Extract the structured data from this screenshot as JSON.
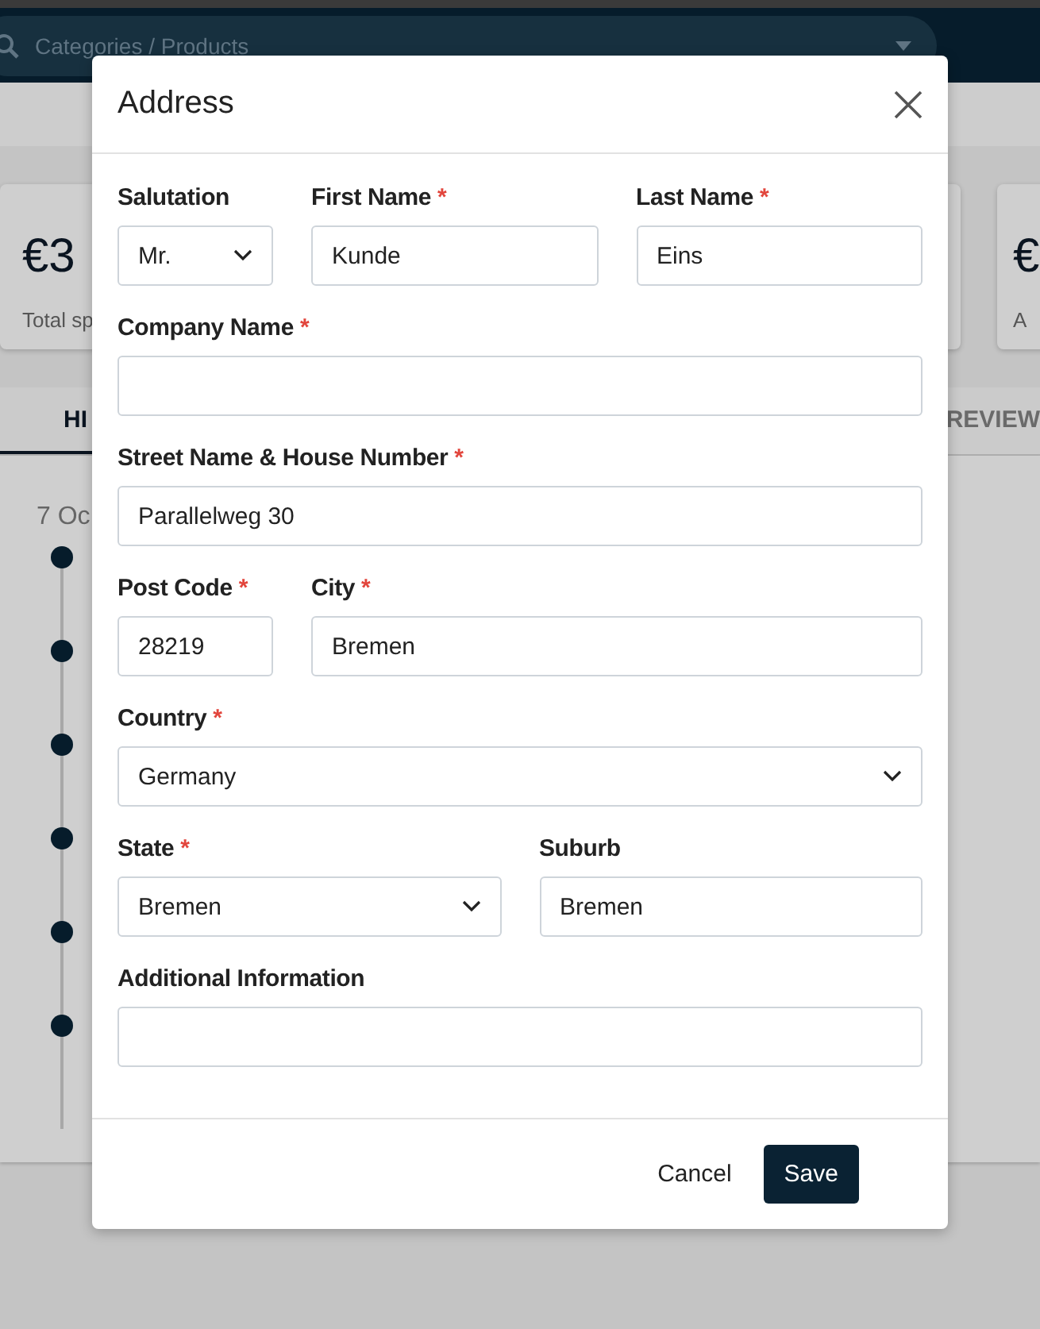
{
  "header": {
    "search": {
      "placeholder": "Categories / Products"
    }
  },
  "cards": [
    {
      "value": "€3",
      "label": "Total sp"
    },
    {
      "value": "€",
      "label": "A"
    }
  ],
  "tabs": [
    {
      "label": "HI",
      "selected": true
    },
    {
      "label": "REVIEW",
      "selected": false
    }
  ],
  "timeline": {
    "date": "7 Oc"
  },
  "dialog": {
    "title": "Address",
    "required_marker": "*",
    "rows": [
      [
        {
          "label": "Salutation",
          "required": false,
          "kind": "select",
          "value": "Mr."
        },
        {
          "label": "First Name",
          "required": true,
          "kind": "text",
          "value": "Kunde"
        },
        {
          "label": "Last Name",
          "required": true,
          "kind": "text",
          "value": "Eins"
        }
      ],
      [
        {
          "label": "Company Name",
          "required": true,
          "kind": "text"
        }
      ],
      [
        {
          "label": "Street Name & House Number",
          "required": true,
          "kind": "text",
          "value": "Parallelweg 30"
        }
      ],
      [
        {
          "label": "Post Code",
          "required": true,
          "kind": "text",
          "value": "28219"
        },
        {
          "label": "City",
          "required": true,
          "kind": "text",
          "value": "Bremen"
        }
      ],
      [
        {
          "label": "Country",
          "required": true,
          "kind": "select",
          "value": "Germany"
        }
      ],
      [
        {
          "label": "State",
          "required": true,
          "kind": "select",
          "value": "Bremen"
        },
        {
          "label": "Suburb",
          "required": false,
          "kind": "text",
          "value": "Bremen"
        }
      ],
      [
        {
          "label": "Additional Information",
          "required": false,
          "kind": "text"
        }
      ]
    ],
    "buttons": [
      {
        "label": "Cancel",
        "kind": "secondary"
      },
      {
        "label": "Save",
        "kind": "primary"
      }
    ]
  }
}
